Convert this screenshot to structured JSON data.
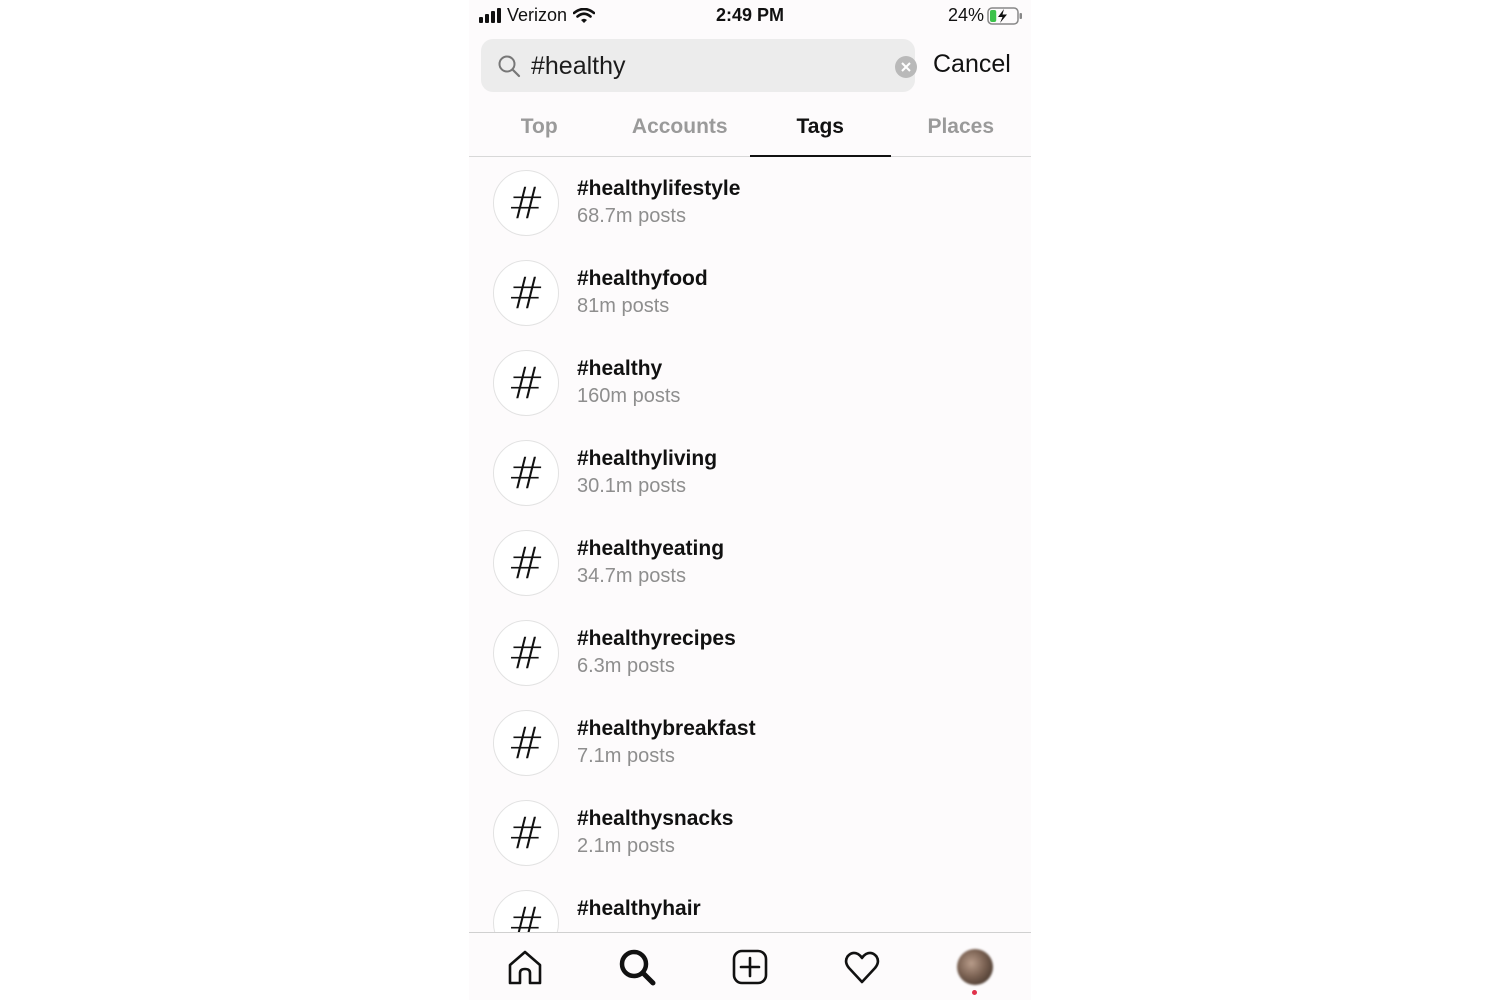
{
  "status_bar": {
    "carrier": "Verizon",
    "time": "2:49 PM",
    "battery": "24%",
    "battery_level": 0.24
  },
  "search": {
    "value": "#healthy",
    "cancel_label": "Cancel"
  },
  "tabs": [
    {
      "label": "Top",
      "active": false
    },
    {
      "label": "Accounts",
      "active": false
    },
    {
      "label": "Tags",
      "active": true
    },
    {
      "label": "Places",
      "active": false
    }
  ],
  "results": [
    {
      "icon": "#",
      "tag": "#healthylifestyle",
      "count": "68.7m posts"
    },
    {
      "icon": "#",
      "tag": "#healthyfood",
      "count": "81m posts"
    },
    {
      "icon": "#",
      "tag": "#healthy",
      "count": "160m posts"
    },
    {
      "icon": "#",
      "tag": "#healthyliving",
      "count": "30.1m posts"
    },
    {
      "icon": "#",
      "tag": "#healthyeating",
      "count": "34.7m posts"
    },
    {
      "icon": "#",
      "tag": "#healthyrecipes",
      "count": "6.3m posts"
    },
    {
      "icon": "#",
      "tag": "#healthybreakfast",
      "count": "7.1m posts"
    },
    {
      "icon": "#",
      "tag": "#healthysnacks",
      "count": "2.1m posts"
    },
    {
      "icon": "#",
      "tag": "#healthyhair",
      "count": ""
    }
  ],
  "bottom_nav": {
    "items": [
      "home-icon",
      "search-icon",
      "new-post-icon",
      "activity-heart-icon",
      "profile-avatar"
    ],
    "notification_color": "#e0304a"
  }
}
